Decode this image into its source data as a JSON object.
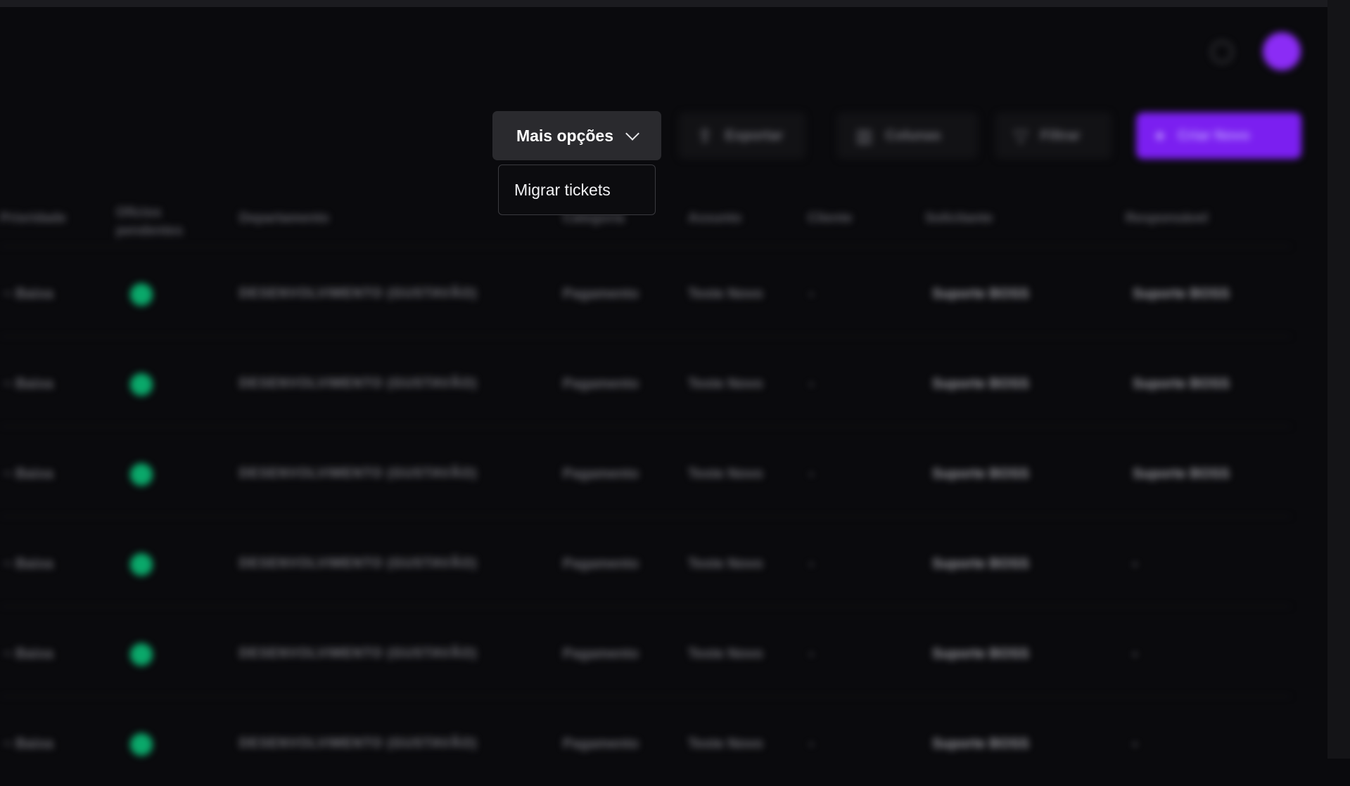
{
  "toolbar": {
    "more_options_label": "Mais opções",
    "export_label": "Exportar",
    "columns_label": "Colunas",
    "filter_label": "Filtrar",
    "create_label": "Criar Novo"
  },
  "dropdown": {
    "items": [
      {
        "label": "Migrar tickets"
      }
    ]
  },
  "table": {
    "headers": [
      "Prioridade",
      "Ofícios pendentes",
      "Departamento",
      "Categoria",
      "Assunto",
      "Cliente",
      "Solicitante",
      "Responsável"
    ],
    "rows": [
      {
        "priority": "~ Baixa",
        "dept": "DESENVOLVIMENTO (GUSTAVÃO)",
        "category": "Pagamento",
        "subject": "Teste Novo",
        "client": "-",
        "requester": "Suporte BOSS",
        "responsible": "Suporte BOSS"
      },
      {
        "priority": "~ Baixa",
        "dept": "DESENVOLVIMENTO (GUSTAVÃO)",
        "category": "Pagamento",
        "subject": "Teste Novo",
        "client": "-",
        "requester": "Suporte BOSS",
        "responsible": "Suporte BOSS"
      },
      {
        "priority": "~ Baixa",
        "dept": "DESENVOLVIMENTO (GUSTAVÃO)",
        "category": "Pagamento",
        "subject": "Teste Novo",
        "client": "-",
        "requester": "Suporte BOSS",
        "responsible": "Suporte BOSS"
      },
      {
        "priority": "~ Baixa",
        "dept": "DESENVOLVIMENTO (GUSTAVÃO)",
        "category": "Pagamento",
        "subject": "Teste Novo",
        "client": "-",
        "requester": "Suporte BOSS",
        "responsible": "-"
      },
      {
        "priority": "~ Baixa",
        "dept": "DESENVOLVIMENTO (GUSTAVÃO)",
        "category": "Pagamento",
        "subject": "Teste Novo",
        "client": "-",
        "requester": "Suporte BOSS",
        "responsible": "-"
      },
      {
        "priority": "~ Baixa",
        "dept": "DESENVOLVIMENTO (GUSTAVÃO)",
        "category": "Pagamento",
        "subject": "Teste Novo",
        "client": "-",
        "requester": "Suporte BOSS",
        "responsible": "-"
      }
    ]
  },
  "colors": {
    "accent": "#7b1ff0",
    "status_dot": "#0aa86a",
    "background": "#0a0a0d"
  }
}
